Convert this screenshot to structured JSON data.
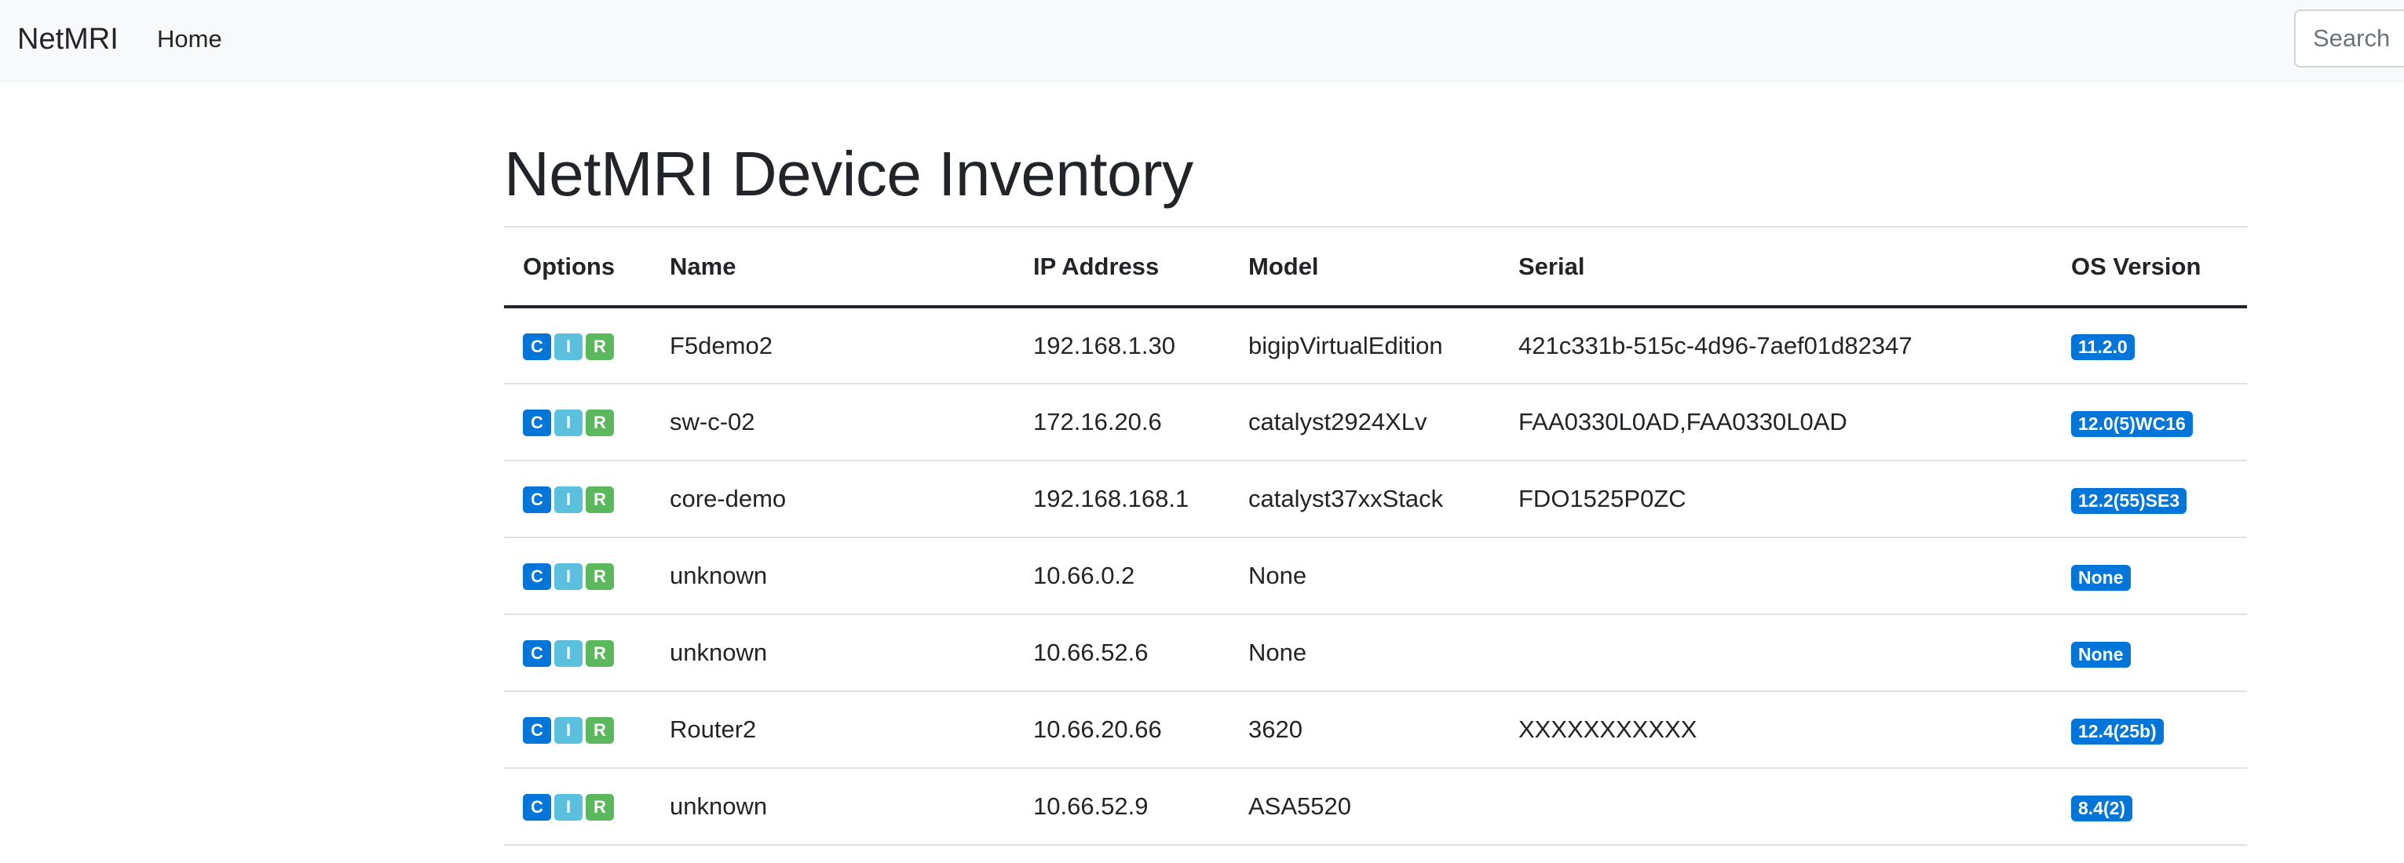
{
  "navbar": {
    "brand": "NetMRI",
    "home_label": "Home",
    "search_placeholder": "Search"
  },
  "page": {
    "title": "NetMRI Device Inventory"
  },
  "table": {
    "headers": {
      "options": "Options",
      "name": "Name",
      "ip": "IP Address",
      "model": "Model",
      "serial": "Serial",
      "os": "OS Version"
    },
    "option_labels": {
      "c": "C",
      "i": "I",
      "r": "R"
    },
    "rows": [
      {
        "name": "F5demo2",
        "ip": "192.168.1.30",
        "model": "bigipVirtualEdition",
        "serial": "421c331b-515c-4d96-7aef01d82347",
        "os": "11.2.0"
      },
      {
        "name": "sw-c-02",
        "ip": "172.16.20.6",
        "model": "catalyst2924XLv",
        "serial": "FAA0330L0AD,FAA0330L0AD",
        "os": "12.0(5)WC16"
      },
      {
        "name": "core-demo",
        "ip": "192.168.168.1",
        "model": "catalyst37xxStack",
        "serial": "FDO1525P0ZC",
        "os": "12.2(55)SE3"
      },
      {
        "name": "unknown",
        "ip": "10.66.0.2",
        "model": "None",
        "serial": "",
        "os": "None"
      },
      {
        "name": "unknown",
        "ip": "10.66.52.6",
        "model": "None",
        "serial": "",
        "os": "None"
      },
      {
        "name": "Router2",
        "ip": "10.66.20.66",
        "model": "3620",
        "serial": "XXXXXXXXXXX",
        "os": "12.4(25b)"
      },
      {
        "name": "unknown",
        "ip": "10.66.52.9",
        "model": "ASA5520",
        "serial": "",
        "os": "8.4(2)"
      }
    ]
  },
  "colors": {
    "btn_c": "#0275d8",
    "btn_i": "#5bc0de",
    "btn_r": "#5cb85c",
    "badge": "#0275d8",
    "navbar_bg": "#f8f9fa"
  }
}
